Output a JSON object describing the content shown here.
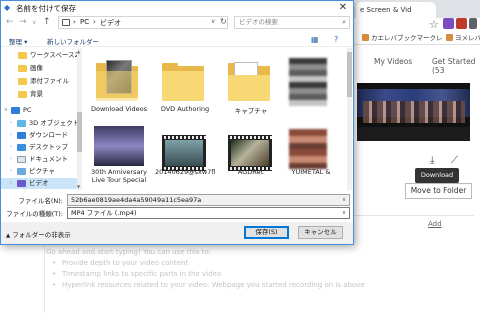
{
  "browser": {
    "tab_title": "e Screen & Vid",
    "bookmarks": [
      "カエレバブックマークレ",
      "ヨメレバ"
    ],
    "tabs": [
      "My Videos",
      "Get Started (53"
    ],
    "tooltip": "Download",
    "move_to_folder": "Move to Folder",
    "add_link": "Add",
    "notes_intro": "Go ahead and start typing! You can use this to:",
    "notes_items": [
      "Provide depth to your video content",
      "Timestamp links to specific parts in the video",
      "Hyperlink resources related to your video: Webpage you started recording on is above"
    ]
  },
  "dialog": {
    "title": "名前を付けて保存",
    "address_segments": [
      "PC",
      "ビデオ"
    ],
    "search_placeholder": "ビデオの検索",
    "organize": "整理 ▾",
    "new_folder": "新しいフォルダー",
    "tree": [
      {
        "label": "ワークスペース2",
        "type": "folder"
      },
      {
        "label": "画像",
        "type": "folder"
      },
      {
        "label": "添付ファイル",
        "type": "folder"
      },
      {
        "label": "背景",
        "type": "folder"
      },
      {
        "label": "PC",
        "type": "pc"
      },
      {
        "label": "3D オブジェクト",
        "type": "3d"
      },
      {
        "label": "ダウンロード",
        "type": "download"
      },
      {
        "label": "デスクトップ",
        "type": "desktop"
      },
      {
        "label": "ドキュメント",
        "type": "docs"
      },
      {
        "label": "ピクチャ",
        "type": "pics"
      },
      {
        "label": "ビデオ",
        "type": "video"
      }
    ],
    "files": [
      {
        "name": "Download Videos",
        "kind": "folder-thumb"
      },
      {
        "name": "DVD Authoring",
        "kind": "folder"
      },
      {
        "name": "キャプチャ",
        "kind": "folder-doc"
      },
      {
        "name": "",
        "kind": "blurred"
      },
      {
        "name": "30th Anniversary Live Tour Special",
        "kind": "video"
      },
      {
        "name": "20140629@sxw7fl",
        "kind": "video"
      },
      {
        "name": "AGDRec",
        "kind": "video"
      },
      {
        "name": "YUIMETAL &",
        "kind": "blurred"
      }
    ],
    "filename_label": "ファイル名(N):",
    "filename_value": "52b6ae0819ae4da4a59049a11c5ea97a",
    "filetype_label": "ファイルの種類(T):",
    "filetype_value": "MP4 ファイル (.mp4)",
    "hide_folders": "フォルダーの非表示",
    "save": "保存(S)",
    "cancel": "キャンセル"
  }
}
